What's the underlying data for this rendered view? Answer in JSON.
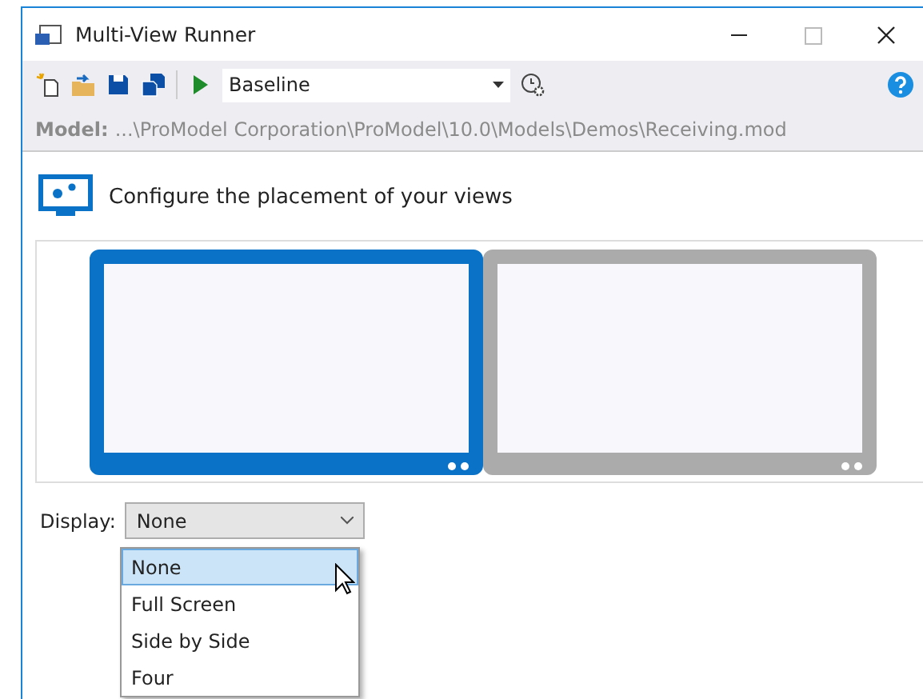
{
  "window": {
    "title": "Multi-View Runner"
  },
  "toolbar": {
    "scenario": "Baseline"
  },
  "model": {
    "label": "Model:",
    "path": "...\\ProModel Corporation\\ProModel\\10.0\\Models\\Demos\\Receiving.mod"
  },
  "heading": "Configure the placement of your views",
  "monitors": [
    {
      "selected": true
    },
    {
      "selected": false
    }
  ],
  "display": {
    "label": "Display:",
    "value": "None",
    "expanded": true,
    "options": [
      {
        "label": "None",
        "selected": true
      },
      {
        "label": "Full Screen",
        "selected": false
      },
      {
        "label": "Side by Side",
        "selected": false
      },
      {
        "label": "Four",
        "selected": false
      }
    ]
  }
}
